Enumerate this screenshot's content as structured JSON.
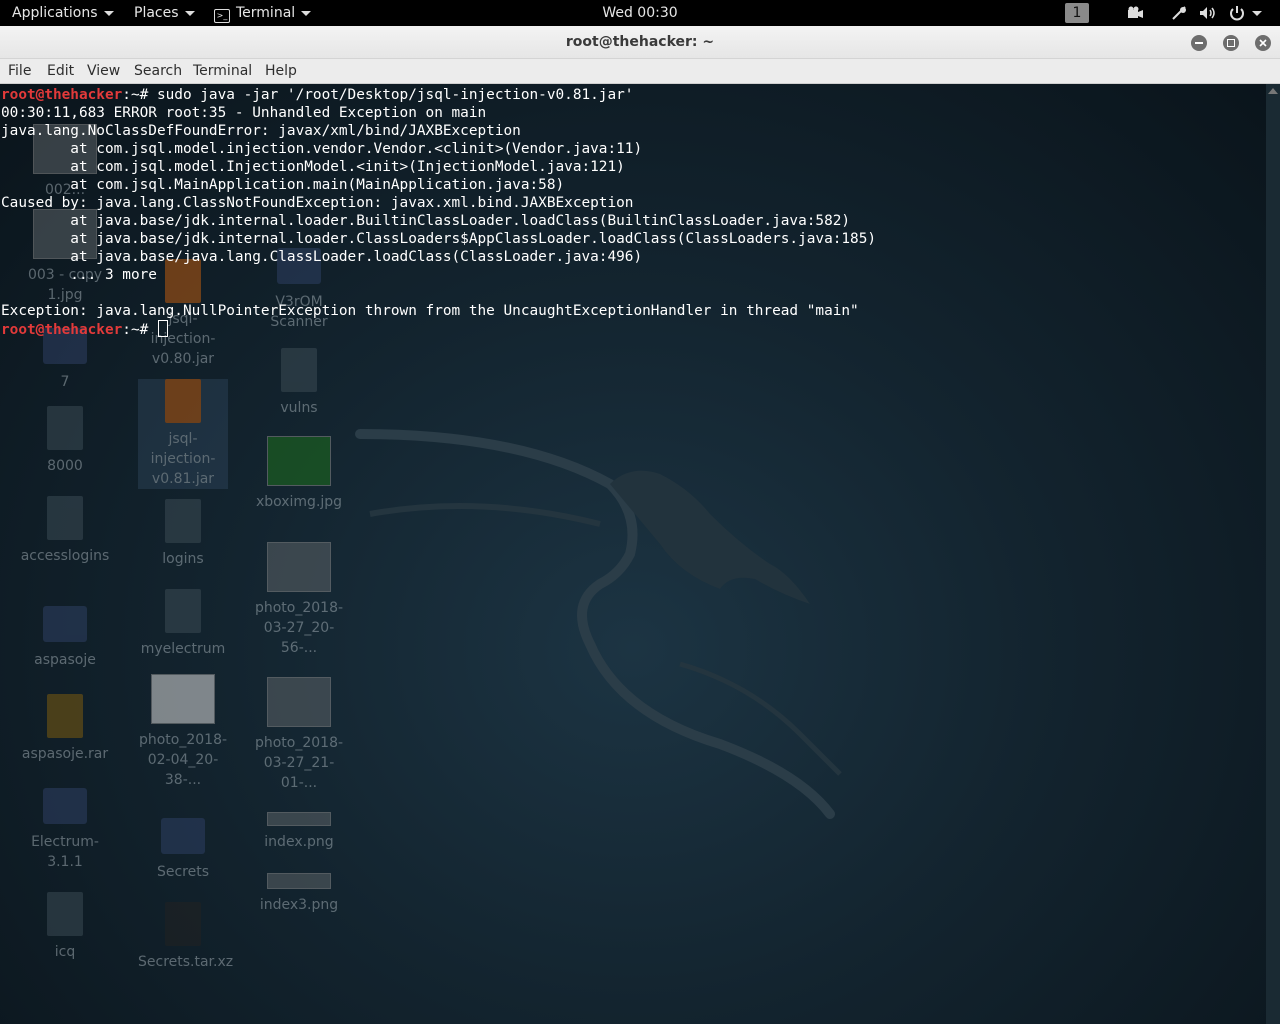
{
  "topbar": {
    "applications": "Applications",
    "places": "Places",
    "terminal": "Terminal",
    "clock": "Wed 00:30",
    "workspace": "1"
  },
  "window": {
    "title": "root@thehacker: ~",
    "menu": [
      "File",
      "Edit",
      "View",
      "Search",
      "Terminal",
      "Help"
    ]
  },
  "prompt": {
    "user": "root@thehacker",
    "path": ":~# "
  },
  "terminal": {
    "command": "sudo java -jar '/root/Desktop/jsql-injection-v0.81.jar'",
    "output": [
      "00:30:11,683 ERROR root:35 - Unhandled Exception on main",
      "java.lang.NoClassDefFoundError: javax/xml/bind/JAXBException",
      "        at com.jsql.model.injection.vendor.Vendor.<clinit>(Vendor.java:11)",
      "        at com.jsql.model.InjectionModel.<init>(InjectionModel.java:121)",
      "        at com.jsql.MainApplication.main(MainApplication.java:58)",
      "Caused by: java.lang.ClassNotFoundException: javax.xml.bind.JAXBException",
      "        at java.base/jdk.internal.loader.BuiltinClassLoader.loadClass(BuiltinClassLoader.java:582)",
      "        at java.base/jdk.internal.loader.ClassLoaders$AppClassLoader.loadClass(ClassLoaders.java:185)",
      "        at java.base/java.lang.ClassLoader.loadClass(ClassLoader.java:496)",
      "        ... 3 more",
      "",
      "Exception: java.lang.NullPointerException thrown from the UncaughtExceptionHandler in thread \"main\""
    ]
  },
  "desktop_icons": [
    {
      "label": "002...",
      "kind": "thumb"
    },
    {
      "label": "003 - copy 1.jpg",
      "kind": "thumb"
    },
    {
      "label": "7",
      "kind": "folder"
    },
    {
      "label": "8000",
      "kind": "doc"
    },
    {
      "label": "accesslogins",
      "kind": "doc"
    },
    {
      "label": "aspasoje",
      "kind": "folder"
    },
    {
      "label": "aspasoje.rar",
      "kind": "doc"
    },
    {
      "label": "Electrum-3.1.1",
      "kind": "folder"
    },
    {
      "label": "icq",
      "kind": "doc"
    },
    {
      "label": "jsql-injection-v0.80.jar",
      "kind": "jar"
    },
    {
      "label": "jsql-injection-v0.81.jar",
      "kind": "jar"
    },
    {
      "label": "logins",
      "kind": "doc"
    },
    {
      "label": "myelectrum",
      "kind": "doc"
    },
    {
      "label": "photo_2018-02-04_20-38-...",
      "kind": "thumb"
    },
    {
      "label": "Secrets",
      "kind": "folder"
    },
    {
      "label": "Secrets.tar.xz",
      "kind": "doc"
    },
    {
      "label": "V3rOM Scanner",
      "kind": "folder"
    },
    {
      "label": "vulns",
      "kind": "doc"
    },
    {
      "label": "xboximg.jpg",
      "kind": "thumb"
    },
    {
      "label": "photo_2018-03-27_20-56-...",
      "kind": "thumb"
    },
    {
      "label": "photo_2018-03-27_21-01-...",
      "kind": "thumb"
    },
    {
      "label": "index.png",
      "kind": "thumb"
    },
    {
      "label": "index3.png",
      "kind": "thumb"
    }
  ]
}
